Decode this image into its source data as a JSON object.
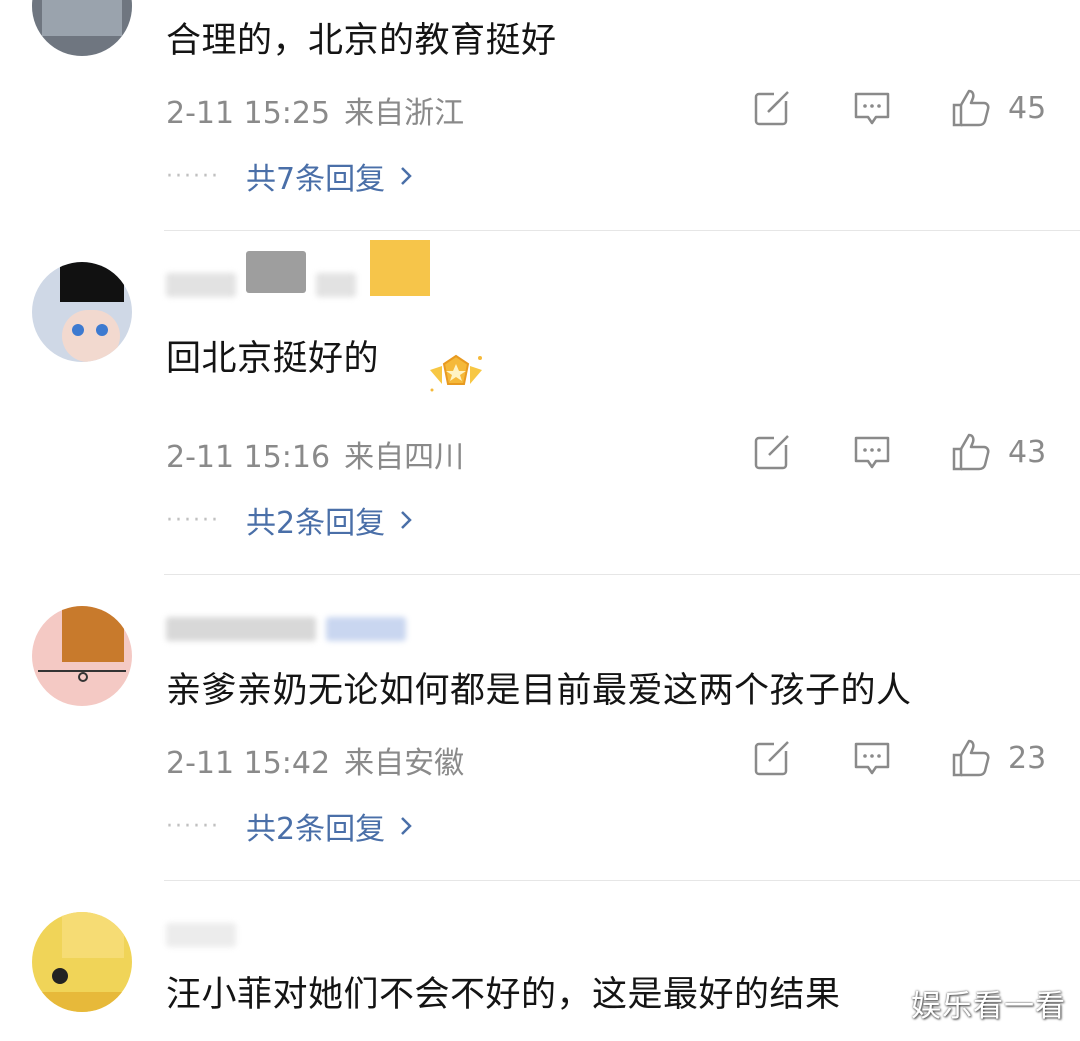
{
  "comments": [
    {
      "content": "合理的，北京的教育挺好",
      "time": "2-11 15:25",
      "location": "来自浙江",
      "likes": "45",
      "replies": "共7条回复"
    },
    {
      "content": "回北京挺好的",
      "time": "2-11 15:16",
      "location": "来自四川",
      "likes": "43",
      "replies": "共2条回复"
    },
    {
      "content": "亲爹亲奶无论如何都是目前最爱这两个孩子的人",
      "time": "2-11 15:42",
      "location": "来自安徽",
      "likes": "23",
      "replies": "共2条回复"
    },
    {
      "content": "汪小菲对她们不会不好的，这是最好的结果"
    }
  ],
  "watermark": "娱乐看一看",
  "colors": {
    "link": "#4a6fa8",
    "meta": "#8a8a8a",
    "divider": "#e6e6e6"
  },
  "icons": [
    "edit-icon",
    "comment-icon",
    "thumbs-up-icon",
    "chevron-right-icon",
    "member-badge-icon"
  ]
}
